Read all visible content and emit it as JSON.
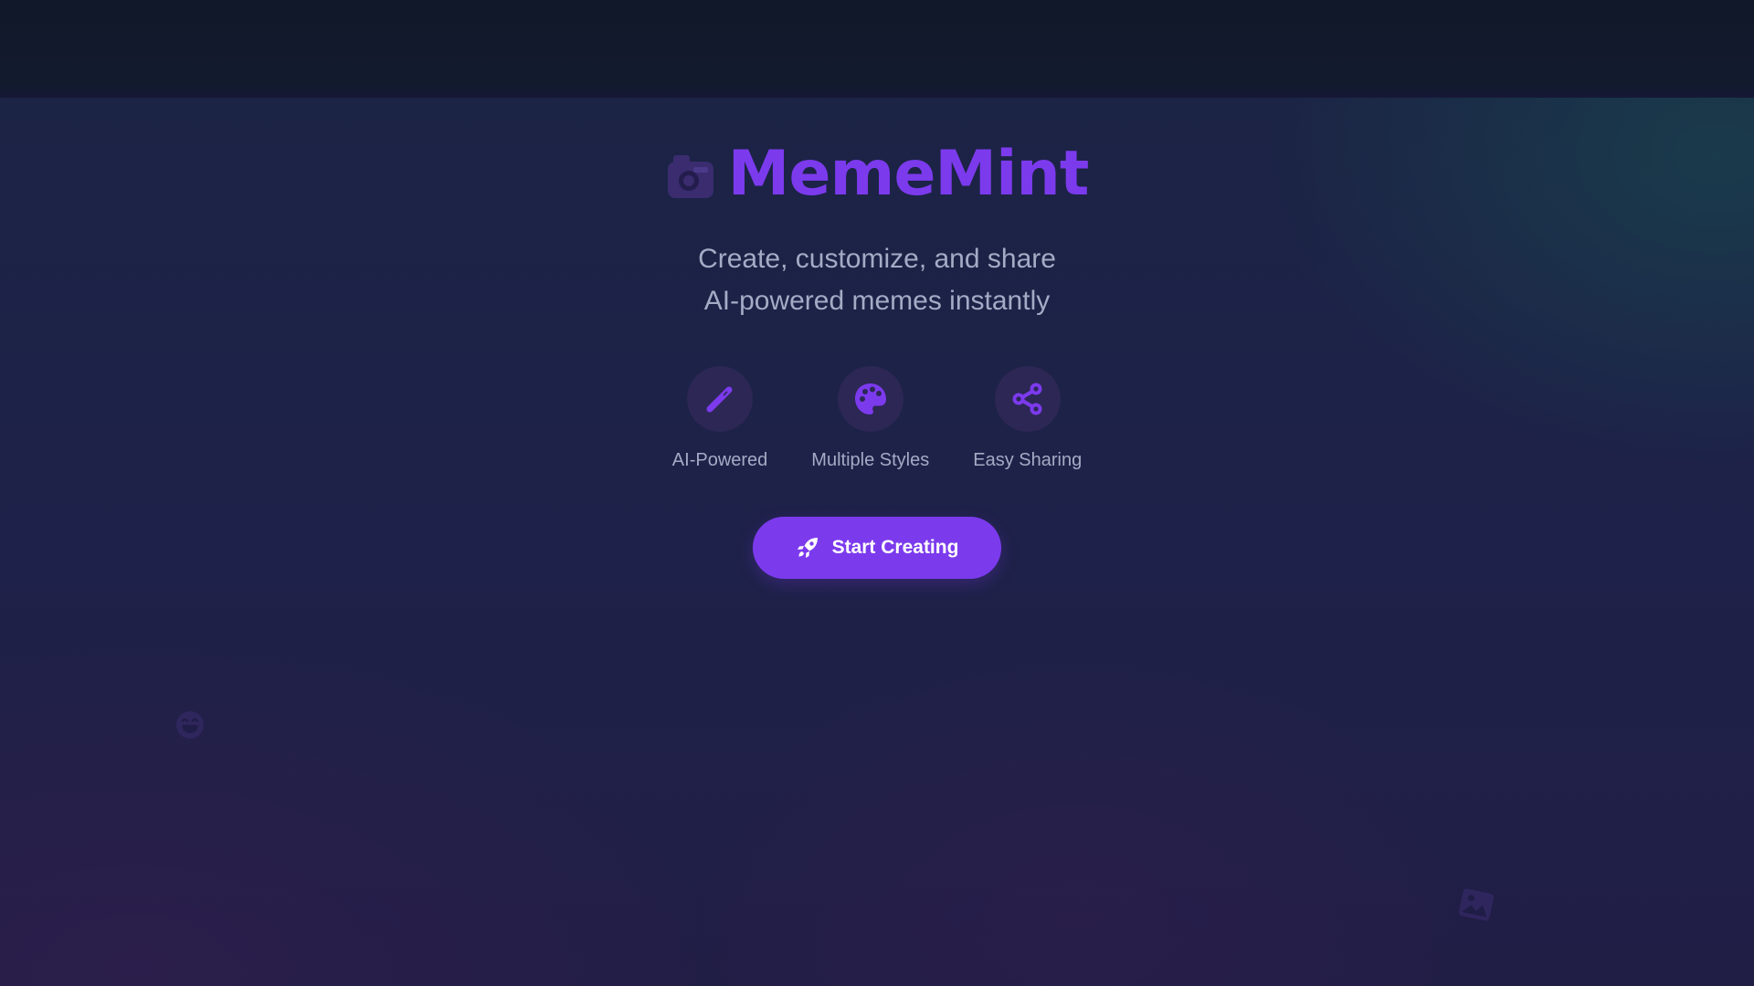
{
  "logo": {
    "icon": "camera-icon",
    "text": "MemeMint"
  },
  "subtitle": {
    "line1": "Create, customize, and share",
    "line2": "AI-powered memes instantly"
  },
  "features": [
    {
      "icon": "magic-wand-icon",
      "label": "AI-Powered"
    },
    {
      "icon": "palette-icon",
      "label": "Multiple Styles"
    },
    {
      "icon": "share-icon",
      "label": "Easy Sharing"
    }
  ],
  "cta": {
    "icon": "rocket-icon",
    "label": "Start Creating"
  },
  "decorations": [
    "laughing-face-icon",
    "image-icon"
  ],
  "colors": {
    "accent": "#7c3aed",
    "text_muted": "#a4abc5",
    "background": "#1e2149",
    "topbar": "#111829",
    "icon_circle": "#2c2755"
  }
}
